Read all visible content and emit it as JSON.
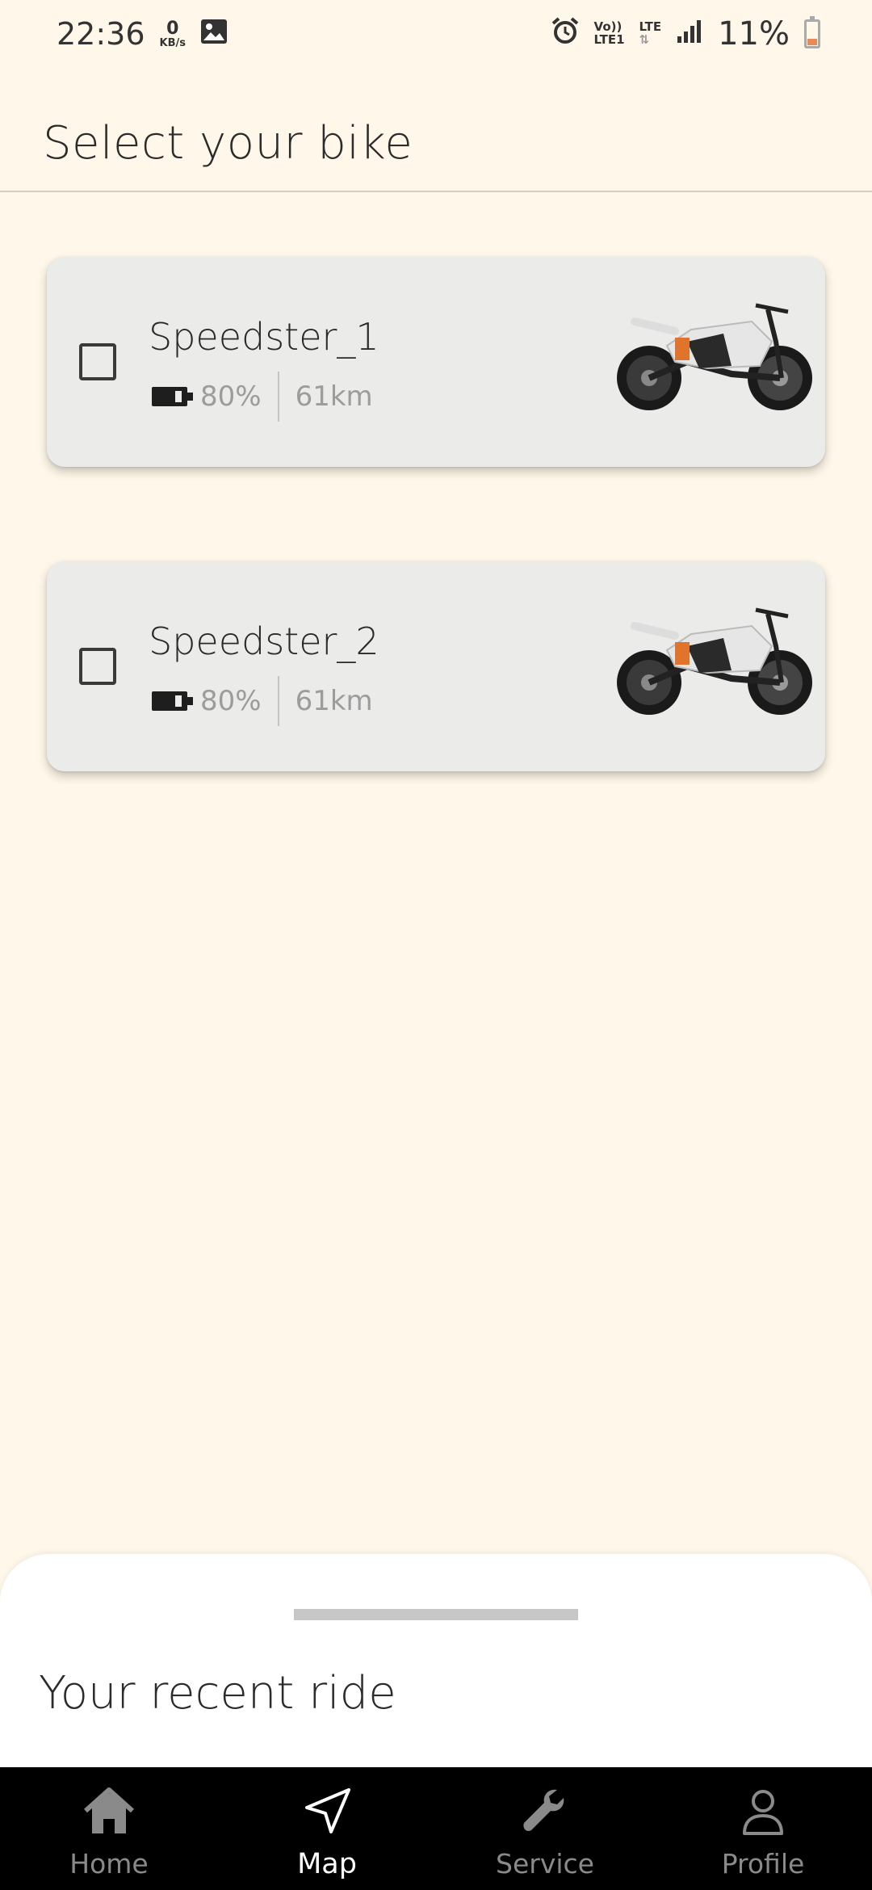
{
  "status_bar": {
    "time": "22:36",
    "speed_value": "0",
    "speed_unit": "KB/s",
    "net_line1": "Vo))",
    "net_line2": "LTE1",
    "net_type": "LTE",
    "battery_percent": "11%",
    "icons": [
      "gallery-icon",
      "alarm-icon",
      "signal-icon",
      "battery-icon"
    ]
  },
  "header": {
    "title": "Select your bike"
  },
  "bikes": [
    {
      "name": "Speedster_1",
      "battery": "80%",
      "range": "61km",
      "selected": false
    },
    {
      "name": "Speedster_2",
      "battery": "80%",
      "range": "61km",
      "selected": false
    }
  ],
  "bottom_sheet": {
    "title": "Your recent ride"
  },
  "nav": {
    "items": [
      {
        "label": "Home",
        "icon": "home-icon",
        "active": false
      },
      {
        "label": "Map",
        "icon": "navigation-arrow-icon",
        "active": true
      },
      {
        "label": "Service",
        "icon": "wrench-icon",
        "active": false
      },
      {
        "label": "Profile",
        "icon": "person-icon",
        "active": false
      }
    ]
  },
  "colors": {
    "background": "#fff8ea",
    "card": "#ebebea",
    "nav_bg": "#000000",
    "accent_orange": "#e0742c"
  }
}
